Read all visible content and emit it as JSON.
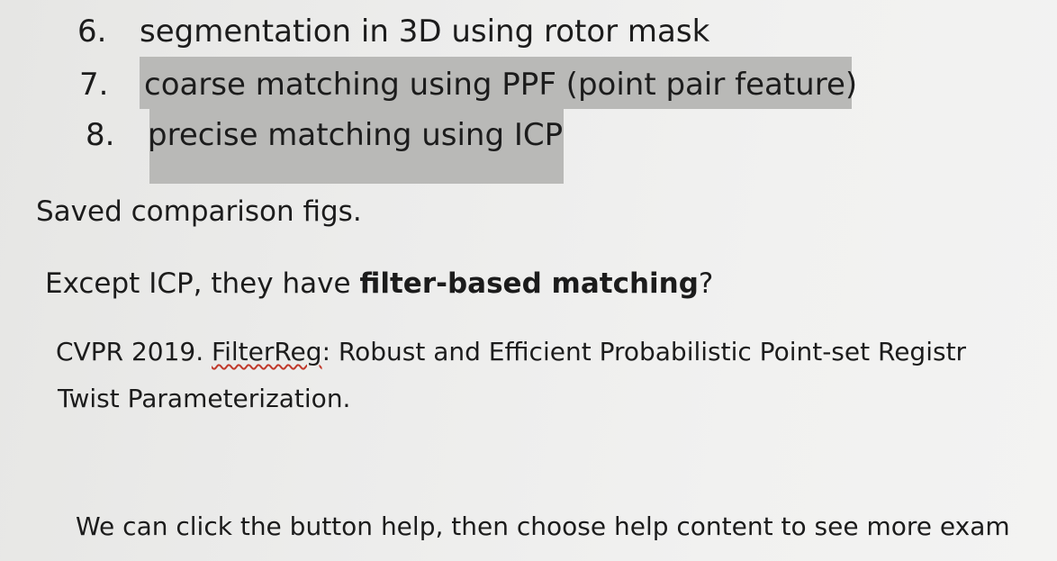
{
  "steps": [
    {
      "number": "6.",
      "text": "segmentation in 3D using rotor mask",
      "highlighted": false
    },
    {
      "number": "7.",
      "text": "coarse matching using PPF (point pair feature)",
      "highlighted": true
    },
    {
      "number": "8.",
      "text": "precise matching using ICP",
      "highlighted": true
    }
  ],
  "saved_note": "Saved comparison figs.",
  "question": {
    "prefix": "Except ICP, they have ",
    "bold": "filter-based matching",
    "suffix": "?"
  },
  "reference": {
    "venue": "CVPR 2019. ",
    "name": "FilterReg",
    "rest": ": Robust and Efficient Probabilistic Point-set Registr",
    "line2": "Twist Parameterization."
  },
  "help_note": "We can click the button help, then choose help content to see more exam",
  "colors": {
    "highlight": "#b9b9b7",
    "spellcheck_underline": "#c0392b"
  }
}
